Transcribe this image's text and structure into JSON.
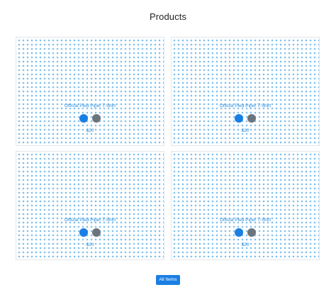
{
  "header": {
    "title": "Products"
  },
  "products": [
    {
      "name": "Official Pied Piper T-Shirt",
      "price": "$20",
      "colors": [
        "#1a7fe3",
        "#6c757d"
      ]
    },
    {
      "name": "Official Pied Piper T-Shirt",
      "price": "$20",
      "colors": [
        "#1a7fe3",
        "#6c757d"
      ]
    },
    {
      "name": "Official Pied Piper T-Shirt",
      "price": "$20",
      "colors": [
        "#1a7fe3",
        "#6c757d"
      ]
    },
    {
      "name": "Official Pied Piper T-Shirt",
      "price": "$20",
      "colors": [
        "#1a7fe3",
        "#6c757d"
      ]
    }
  ],
  "footer": {
    "button_label": "All Items"
  },
  "theme": {
    "accent": "#1a7fe3",
    "link": "#2d8fe0",
    "pattern_dot": "#7fc1ec",
    "secondary_swatch": "#6c757d"
  }
}
